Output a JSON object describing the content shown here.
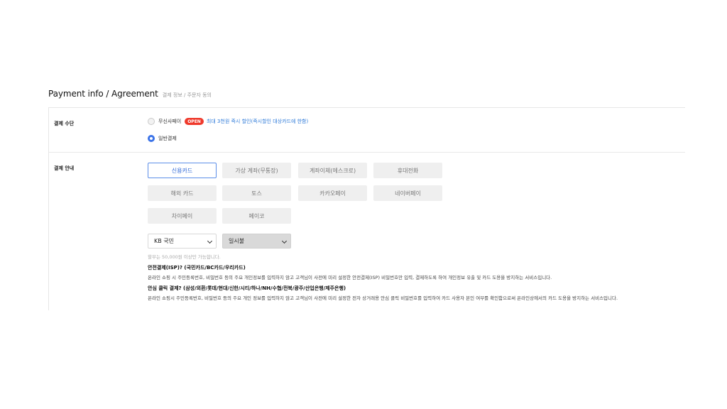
{
  "header": {
    "title": "Payment info / Agreement",
    "subtitle": "결제 정보 / 주문자 동의"
  },
  "payment_method": {
    "label": "결제 수단",
    "options": [
      {
        "label": "무신사페이",
        "badge": "OPEN",
        "promo": "최대 3천원 즉시 할인(즉시할인 대상카드에 한함)",
        "selected": false
      },
      {
        "label": "일반결제",
        "selected": true
      }
    ]
  },
  "payment_guide": {
    "label": "결제 안내",
    "methods": [
      "신용카드",
      "가상 계좌(무통장)",
      "계좌이체(에스크로)",
      "휴대전화",
      "해외 카드",
      "토스",
      "카카오페이",
      "네이버페이",
      "차이페이",
      "페이코"
    ],
    "active_method": "신용카드",
    "card_select": {
      "value": "KB 국민"
    },
    "installment_select": {
      "value": "일시불"
    },
    "installment_note": "할부는 50,000원 이상만 가능합니다.",
    "isp": {
      "title": "안전결제(ISP)? (국민카드/BC카드/우리카드)",
      "desc": "온라인 쇼핑 시 주민등록번호, 비밀번호 등의 주요 개인정보를 입력하지 않고 고객님이 사전에 미리 설정한 안전결제(ISP) 비밀번호만 입력, 결제하도록 하여 개인정보 유출 및 카드 도용을 방지하는 서비스입니다."
    },
    "safe_click": {
      "title": "안심 클릭 결제? (삼성/외환/롯데/현대/신한/시티/하나/NH/수협/전북/광주/산업은행/제주은행)",
      "desc": "온라인 쇼핑시 주민등록번호, 비밀번호 등의 주요 개인 정보를 입력하지 않고 고객님이 사전에 미리 설정한 전자 상거래용 안심 클릭 비밀번호를 입력하여 카드 사용자 본인 여부를 확인함으로써 온라인상에서의 카드 도용을 방지하는 서비스입니다."
    }
  },
  "colors": {
    "accent": "#3b73e8",
    "badge": "#ef3a2c",
    "promo": "#2f7bd9"
  }
}
